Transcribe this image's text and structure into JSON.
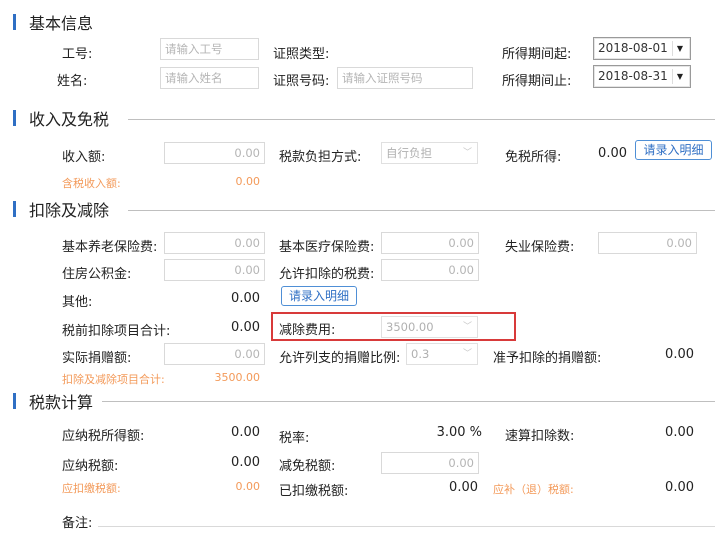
{
  "sections": {
    "basic": "基本信息",
    "income": "收入及免税",
    "deduction": "扣除及减除",
    "tax": "税款计算"
  },
  "basic": {
    "emp_id_label": "工号:",
    "emp_id_placeholder": "请输入工号",
    "name_label": "姓名:",
    "name_placeholder": "请输入姓名",
    "id_type_label": "证照类型:",
    "id_no_label": "证照号码:",
    "id_no_placeholder": "请输入证照号码",
    "period_start_label": "所得期间起:",
    "period_start_value": "2018-08-01",
    "period_end_label": "所得期间止:",
    "period_end_value": "2018-08-31"
  },
  "income": {
    "income_label": "收入额:",
    "income_value": "0.00",
    "tax_burden_label": "税款负担方式:",
    "tax_burden_value": "自行负担",
    "tax_free_label": "免税所得:",
    "tax_free_value": "0.00",
    "detail_button": "请录入明细",
    "taxable_income_label": "含税收入额:",
    "taxable_income_value": "0.00"
  },
  "deduction": {
    "pension_label": "基本养老保险费:",
    "pension_value": "0.00",
    "medical_label": "基本医疗保险费:",
    "medical_value": "0.00",
    "unemployment_label": "失业保险费:",
    "unemployment_value": "0.00",
    "housing_label": "住房公积金:",
    "housing_value": "0.00",
    "allowed_tax_label": "允许扣除的税费:",
    "allowed_tax_value": "0.00",
    "other_label": "其他:",
    "other_value": "0.00",
    "detail_button": "请录入明细",
    "pretax_total_label": "税前扣除项目合计:",
    "pretax_total_value": "0.00",
    "reduction_label": "减除费用:",
    "reduction_value": "3500.00",
    "donation_label": "实际捐赠额:",
    "donation_value": "0.00",
    "donation_ratio_label": "允许列支的捐赠比例:",
    "donation_ratio_value": "0.3",
    "allowed_donation_label": "准予扣除的捐赠额:",
    "allowed_donation_value": "0.00",
    "total_label": "扣除及减除项目合计:",
    "total_value": "3500.00"
  },
  "tax": {
    "taxable_label": "应纳税所得额:",
    "taxable_value": "0.00",
    "rate_label": "税率:",
    "rate_value": "3.00 %",
    "quick_deduction_label": "速算扣除数:",
    "quick_deduction_value": "0.00",
    "tax_payable_label": "应纳税额:",
    "tax_payable_value": "0.00",
    "tax_relief_label": "减免税额:",
    "tax_relief_value": "0.00",
    "withholding_label": "应扣缴税额:",
    "withholding_value": "0.00",
    "paid_label": "已扣缴税额:",
    "paid_value": "0.00",
    "refund_label": "应补（退）税额:",
    "refund_value": "0.00",
    "remark_label": "备注:"
  },
  "colors": {
    "accent": "#2f6fc4",
    "orange": "#f39a5a",
    "highlight": "#d83a3a"
  }
}
